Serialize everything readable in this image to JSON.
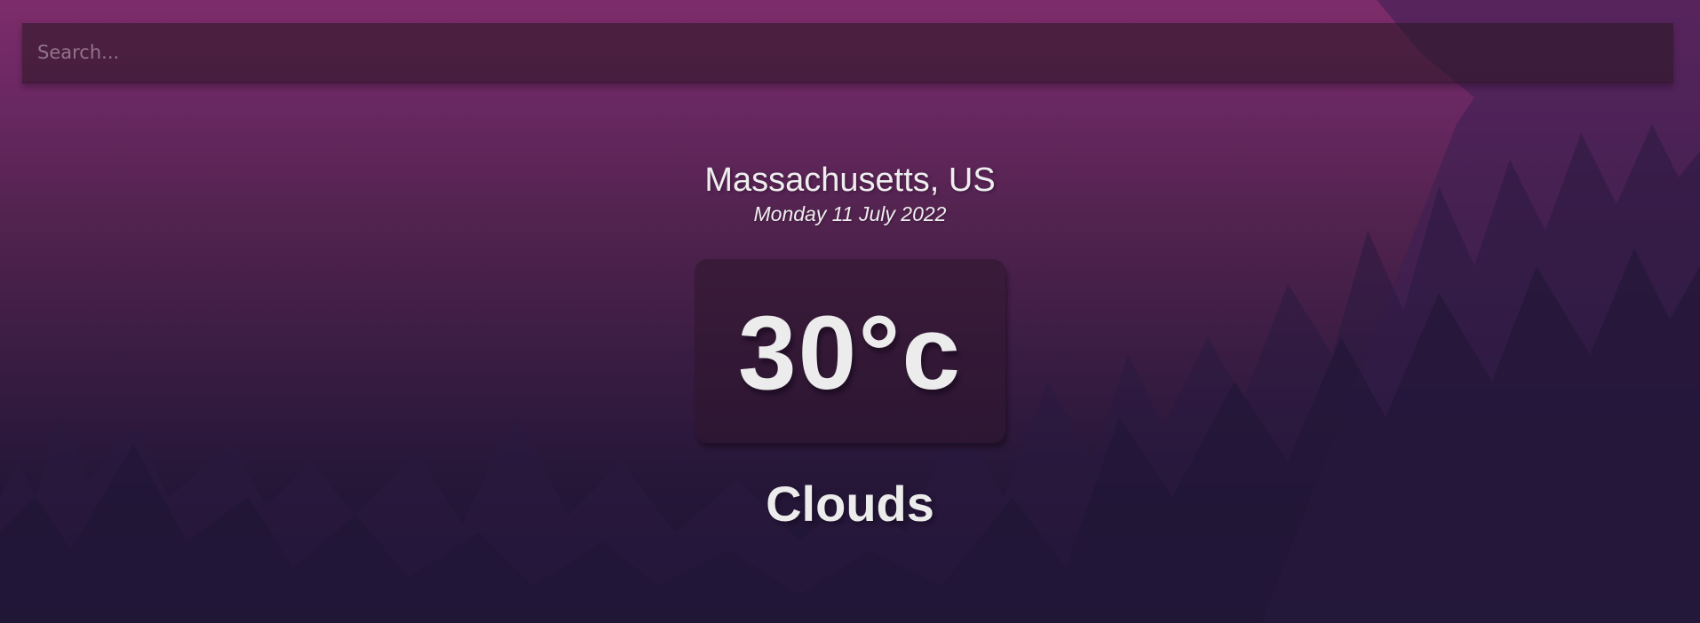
{
  "search": {
    "placeholder": "Search...",
    "value": ""
  },
  "location": {
    "city_country": "Massachusetts, US",
    "date": "Monday 11 July 2022"
  },
  "weather": {
    "temperature": "30°c",
    "condition": "Clouds"
  },
  "colors": {
    "top_background": "#7d2c6a",
    "bottom_background": "#1a1432",
    "text": "#ececec"
  }
}
